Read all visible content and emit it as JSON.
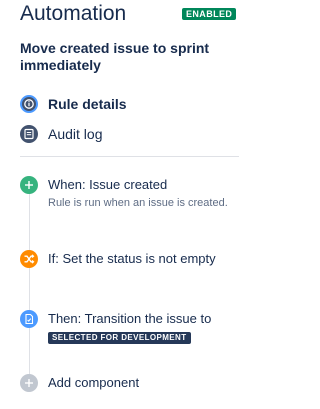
{
  "header": {
    "title": "Automation",
    "status": "ENABLED"
  },
  "rule": {
    "name": "Move created issue to sprint immediately"
  },
  "nav": {
    "items": [
      {
        "label": "Rule details",
        "icon": "info-icon",
        "active": true
      },
      {
        "label": "Audit log",
        "icon": "log-icon",
        "active": false
      }
    ]
  },
  "components": {
    "trigger": {
      "title": "When: Issue created",
      "description": "Rule is run when an issue is created.",
      "icon": "plus-icon",
      "color": "#36b37e"
    },
    "condition": {
      "title": "If: Set the status is not empty",
      "icon": "shuffle-icon",
      "color": "#ff8b00"
    },
    "action": {
      "title": "Then: Transition the issue to",
      "value": "SELECTED FOR DEVELOPMENT",
      "icon": "document-icon",
      "color": "#4c9aff"
    },
    "add": {
      "label": "Add component",
      "icon": "plus-icon",
      "color": "#c1c7d0"
    }
  },
  "colors": {
    "text_primary": "#172b4d",
    "text_subtle": "#5e6c84",
    "enabled": "#00875a",
    "lozenge_dark": "#253858",
    "nav_icon": "#42526e",
    "focus_ring": "#4c9aff",
    "divider": "#dfe1e6"
  }
}
